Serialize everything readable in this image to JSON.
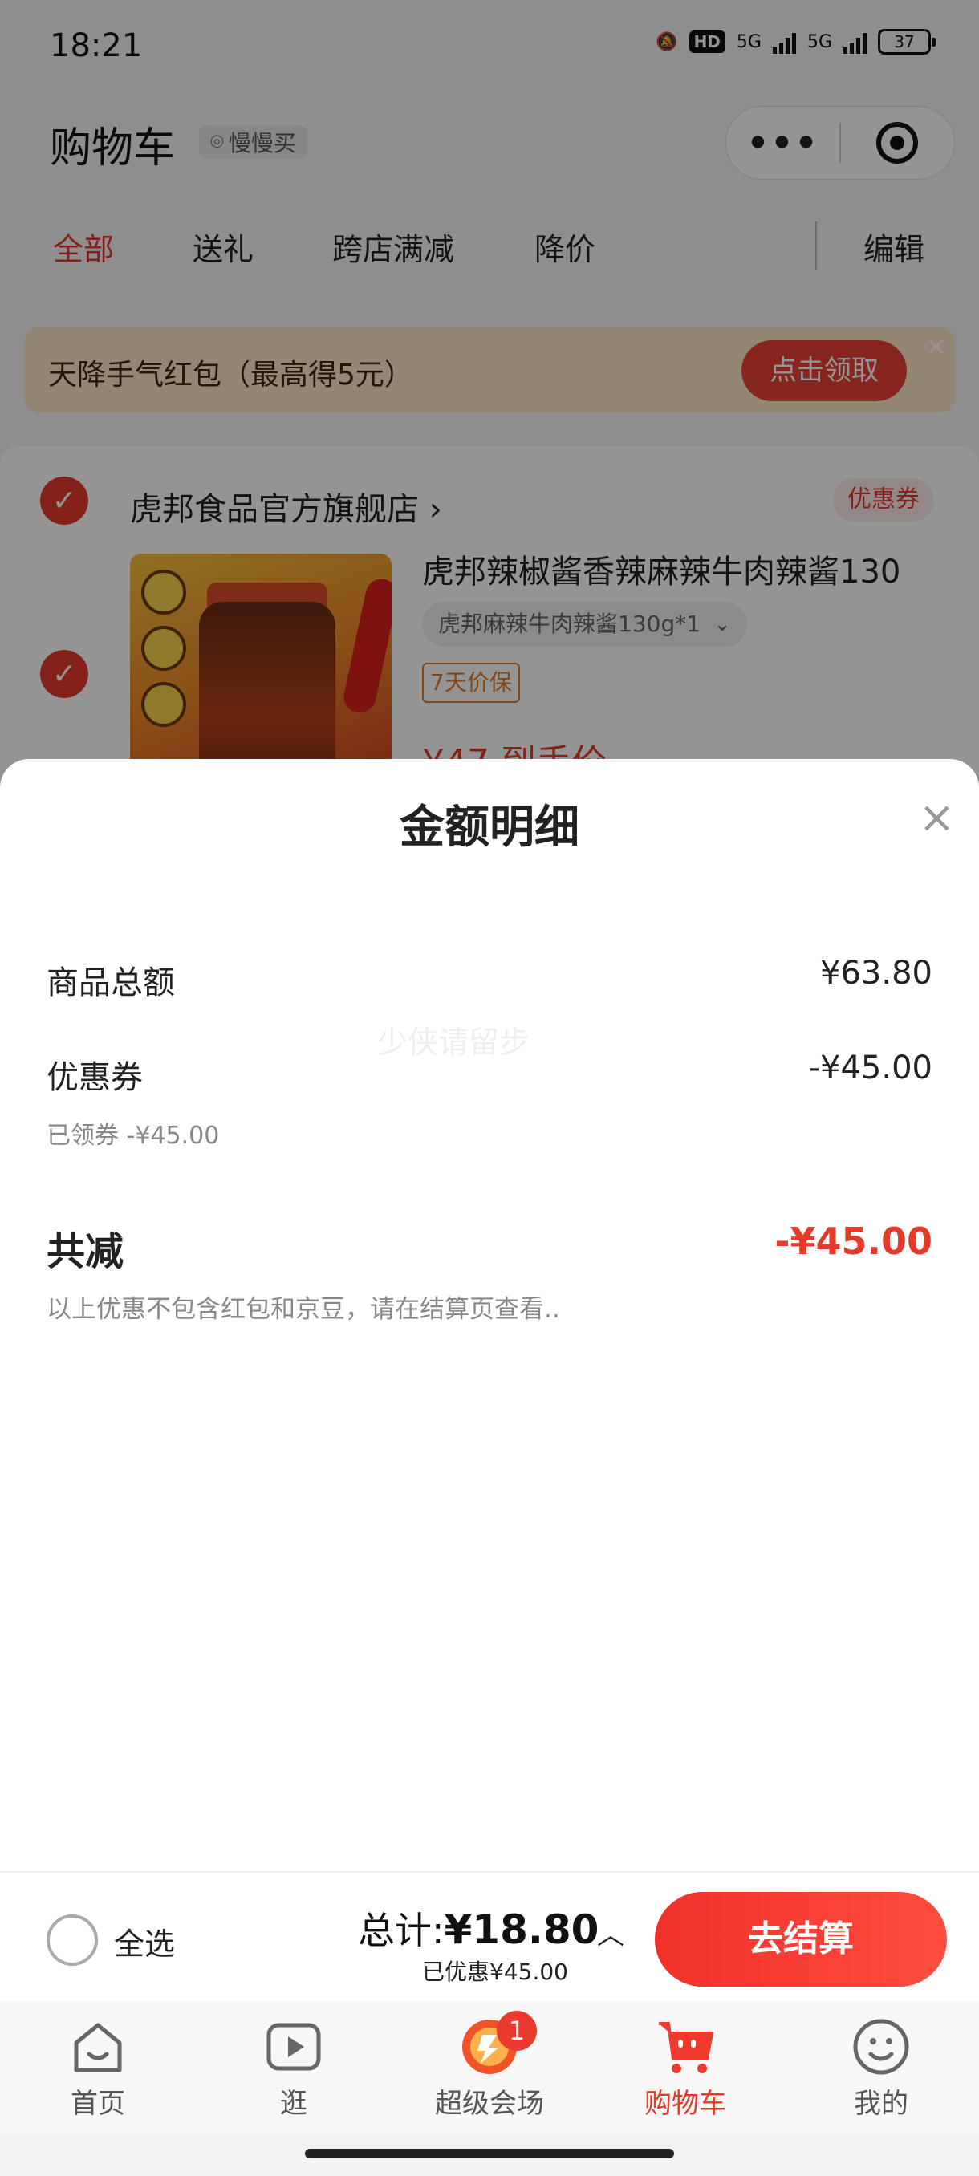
{
  "status_bar": {
    "time": "18:21",
    "hd": "HD",
    "net1": "5G",
    "net2": "5G",
    "battery": "37"
  },
  "header": {
    "title": "购物车",
    "location": "慢慢买",
    "capsule_more": "•••"
  },
  "filter_tabs": [
    "全部",
    "送礼",
    "跨店满减",
    "降价"
  ],
  "filter_edit": "编辑",
  "banner": {
    "text": "天降手气红包（最高得5元）",
    "button": "点击领取",
    "close": "×"
  },
  "store": {
    "name": "虎邦食品官方旗舰店 ›",
    "coupon_tag": "优惠券",
    "product_title": "虎邦辣椒酱香辣麻辣牛肉辣酱130",
    "sku": "虎邦麻辣牛肉辣酱130g*1",
    "protect_tag": "7天价保",
    "price_peek": "¥47 到手价"
  },
  "sheet": {
    "title": "金额明细",
    "close": "×",
    "goods_total_label": "商品总额",
    "goods_total_value": "¥63.80",
    "coupon_label": "优惠券",
    "coupon_value": "-¥45.00",
    "coupon_sub": "已领券 -¥45.00",
    "watermark": "少侠请留步",
    "total_reduce_label": "共减",
    "total_reduce_value": "-¥45.00",
    "note": "以上优惠不包含红包和京豆，请在结算页查看.."
  },
  "checkout": {
    "select_all": "全选",
    "total_prefix": "总计:",
    "total_value": "¥18.80",
    "saved": "已优惠¥45.00",
    "caret": "︿",
    "button": "去结算"
  },
  "tab_bar": {
    "items": [
      {
        "label": "首页",
        "icon": "home-icon"
      },
      {
        "label": "逛",
        "icon": "play-icon"
      },
      {
        "label": "超级会场",
        "icon": "super-venue-icon",
        "badge": "1"
      },
      {
        "label": "购物车",
        "icon": "cart-icon",
        "active": true
      },
      {
        "label": "我的",
        "icon": "profile-icon"
      }
    ]
  },
  "colors": {
    "accent": "#e33a2a",
    "banner_bg": "#fde7c4"
  }
}
